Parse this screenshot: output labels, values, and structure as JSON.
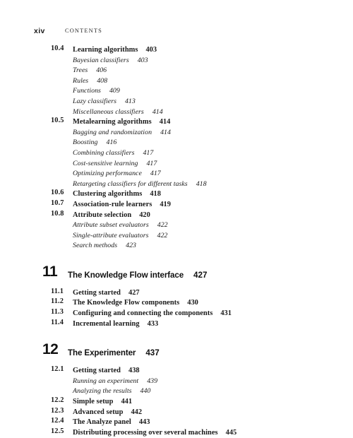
{
  "page": {
    "folio": "xiv",
    "running_head": "CONTENTS",
    "background_color": "#ffffff",
    "text_color": "#1a1a1a"
  },
  "toc": {
    "blocks": [
      {
        "kind": "section",
        "number": "10.4",
        "title": "Learning algorithms",
        "page": "403",
        "subs": [
          {
            "title": "Bayesian classifiers",
            "page": "403"
          },
          {
            "title": "Trees",
            "page": "406"
          },
          {
            "title": "Rules",
            "page": "408"
          },
          {
            "title": "Functions",
            "page": "409"
          },
          {
            "title": "Lazy classifiers",
            "page": "413"
          },
          {
            "title": "Miscellaneous classifiers",
            "page": "414"
          }
        ]
      },
      {
        "kind": "section",
        "number": "10.5",
        "title": "Metalearning algorithms",
        "page": "414",
        "subs": [
          {
            "title": "Bagging and randomization",
            "page": "414"
          },
          {
            "title": "Boosting",
            "page": "416"
          },
          {
            "title": "Combining classifiers",
            "page": "417"
          },
          {
            "title": "Cost-sensitive learning",
            "page": "417"
          },
          {
            "title": "Optimizing performance",
            "page": "417"
          },
          {
            "title": "Retargeting classifiers for different tasks",
            "page": "418"
          }
        ]
      },
      {
        "kind": "section",
        "number": "10.6",
        "title": "Clustering algorithms",
        "page": "418",
        "subs": []
      },
      {
        "kind": "section",
        "number": "10.7",
        "title": "Association-rule learners",
        "page": "419",
        "subs": []
      },
      {
        "kind": "section",
        "number": "10.8",
        "title": "Attribute selection",
        "page": "420",
        "subs": [
          {
            "title": "Attribute subset evaluators",
            "page": "422"
          },
          {
            "title": "Single-attribute evaluators",
            "page": "422"
          },
          {
            "title": "Search methods",
            "page": "423"
          }
        ]
      },
      {
        "kind": "chapter",
        "number": "11",
        "title": "The Knowledge Flow interface",
        "page": "427"
      },
      {
        "kind": "section",
        "number": "11.1",
        "title": "Getting started",
        "page": "427",
        "subs": []
      },
      {
        "kind": "section",
        "number": "11.2",
        "title": "The Knowledge Flow components",
        "page": "430",
        "subs": []
      },
      {
        "kind": "section",
        "number": "11.3",
        "title": "Configuring and connecting the components",
        "page": "431",
        "subs": []
      },
      {
        "kind": "section",
        "number": "11.4",
        "title": "Incremental learning",
        "page": "433",
        "subs": []
      },
      {
        "kind": "chapter",
        "number": "12",
        "title": "The Experimenter",
        "page": "437"
      },
      {
        "kind": "section",
        "number": "12.1",
        "title": "Getting started",
        "page": "438",
        "subs": [
          {
            "title": "Running an experiment",
            "page": "439"
          },
          {
            "title": "Analyzing the results",
            "page": "440"
          }
        ]
      },
      {
        "kind": "section",
        "number": "12.2",
        "title": "Simple setup",
        "page": "441",
        "subs": []
      },
      {
        "kind": "section",
        "number": "12.3",
        "title": "Advanced setup",
        "page": "442",
        "subs": []
      },
      {
        "kind": "section",
        "number": "12.4",
        "title": "The Analyze panel",
        "page": "443",
        "subs": []
      },
      {
        "kind": "section",
        "number": "12.5",
        "title": "Distributing processing over several machines",
        "page": "445",
        "subs": []
      }
    ]
  }
}
